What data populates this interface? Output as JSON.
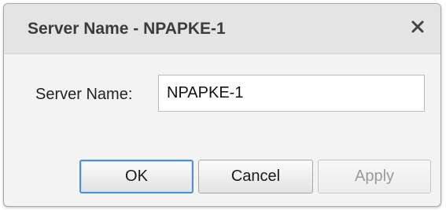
{
  "dialog": {
    "title": "Server Name - NPAPKE-1",
    "close_icon": "close-icon"
  },
  "form": {
    "server_name_label": "Server Name:",
    "server_name_value": "NPAPKE-1"
  },
  "buttons": {
    "ok_label": "OK",
    "cancel_label": "Cancel",
    "apply_label": "Apply",
    "apply_disabled": true
  },
  "colors": {
    "focus_border": "#4d90d4",
    "disabled_text": "#9a9a9a"
  }
}
